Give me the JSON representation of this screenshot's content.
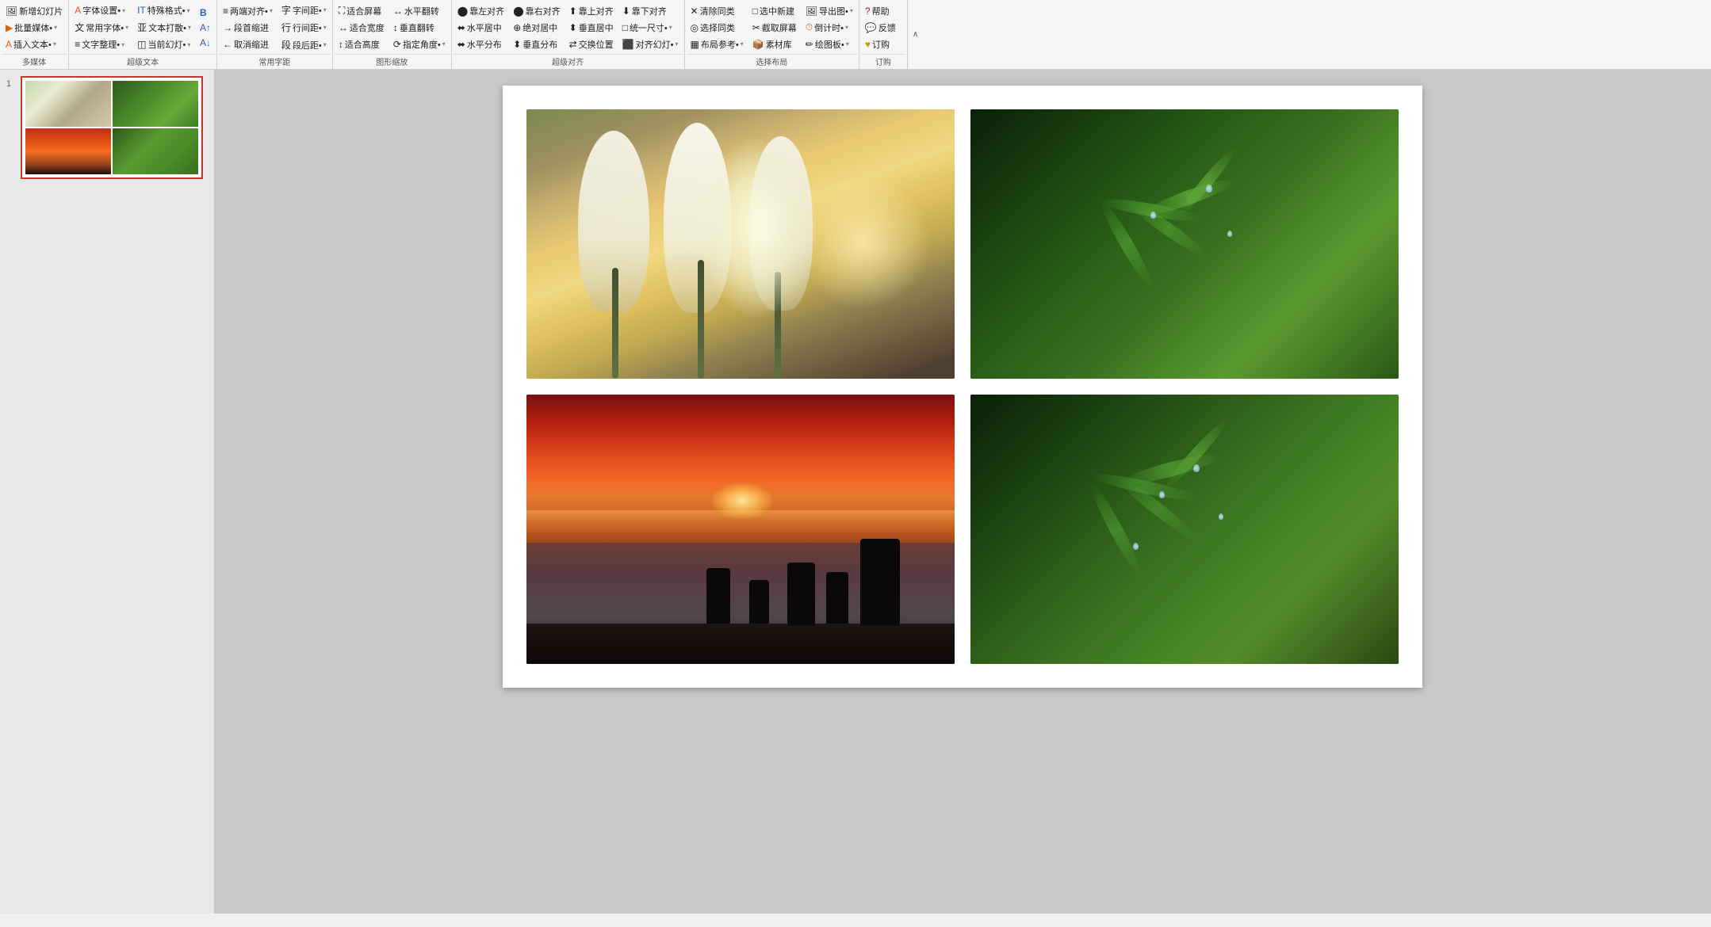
{
  "ribbon": {
    "groups": [
      {
        "id": "multimedia",
        "label": "多媒体",
        "rows": [
          [
            {
              "label": "新增幻灯片",
              "icon": "🖼",
              "hasArrow": false,
              "color": "normal"
            },
            {
              "label": "批量媒体•",
              "icon": "🎬",
              "hasArrow": true,
              "color": "orange"
            }
          ],
          [
            {
              "label": "插入文本•",
              "icon": "A",
              "hasArrow": true,
              "color": "orange"
            }
          ]
        ]
      },
      {
        "id": "supertext",
        "label": "超级文本",
        "rows": [
          [
            {
              "label": "字体设置•",
              "icon": "A",
              "hasArrow": true,
              "color": "orange"
            },
            {
              "label": "特殊格式•",
              "icon": "IT",
              "hasArrow": true,
              "color": "blue"
            },
            {
              "label": "B",
              "icon": "B",
              "hasArrow": false,
              "color": "blue"
            }
          ],
          [
            {
              "label": "常用字体•",
              "icon": "文",
              "hasArrow": true,
              "color": "normal"
            },
            {
              "label": "文本打散•",
              "icon": "亚",
              "hasArrow": true,
              "color": "normal"
            },
            {
              "label": "A↑",
              "icon": "A",
              "hasArrow": false,
              "color": "blue"
            }
          ],
          [
            {
              "label": "文字整理•",
              "icon": "≡",
              "hasArrow": true,
              "color": "normal"
            },
            {
              "label": "当前幻灯•",
              "icon": "◫",
              "hasArrow": true,
              "color": "normal"
            },
            {
              "label": "A↓",
              "icon": "A",
              "hasArrow": false,
              "color": "blue"
            }
          ]
        ]
      },
      {
        "id": "spacing",
        "label": "常用字距",
        "rows": [
          [
            {
              "label": "两端对齐•",
              "icon": "≡",
              "hasArrow": true
            },
            {
              "label": "字间距•",
              "icon": "字",
              "hasArrow": true
            }
          ],
          [
            {
              "label": "段首缩进",
              "icon": "→",
              "hasArrow": false
            },
            {
              "label": "行间距•",
              "icon": "行",
              "hasArrow": true
            }
          ],
          [
            {
              "label": "取消缩进",
              "icon": "←",
              "hasArrow": false
            },
            {
              "label": "段后距•",
              "icon": "段",
              "hasArrow": true
            }
          ]
        ]
      },
      {
        "id": "fitscreen",
        "label": "图形缩放",
        "rows": [
          [
            {
              "label": "适合屏幕",
              "icon": "⛶",
              "hasArrow": false
            },
            {
              "label": "水平翻转",
              "icon": "↔",
              "hasArrow": false
            }
          ],
          [
            {
              "label": "适合宽度",
              "icon": "↔",
              "hasArrow": false
            },
            {
              "label": "垂直翻转",
              "icon": "↕",
              "hasArrow": false
            }
          ],
          [
            {
              "label": "适合高度",
              "icon": "↕",
              "hasArrow": false
            },
            {
              "label": "指定角度•",
              "icon": "⟳",
              "hasArrow": true
            }
          ]
        ]
      },
      {
        "id": "superalign",
        "label": "超级对齐",
        "rows": [
          [
            {
              "label": "靠左对齐",
              "icon": "◧"
            },
            {
              "label": "靠右对齐",
              "icon": "◨"
            },
            {
              "label": "靠上对齐",
              "icon": "⬆"
            },
            {
              "label": "靠下对齐",
              "icon": "⬇"
            }
          ],
          [
            {
              "label": "水平居中",
              "icon": "⬌"
            },
            {
              "label": "绝对居中",
              "icon": "⊕"
            },
            {
              "label": "垂直居中",
              "icon": "⬍"
            },
            {
              "label": "统一尺寸•",
              "icon": "□",
              "hasArrow": true
            }
          ],
          [
            {
              "label": "水平分布",
              "icon": "⬌"
            },
            {
              "label": "垂直分布",
              "icon": "⬍"
            },
            {
              "label": "交换位置",
              "icon": "⇄"
            },
            {
              "label": "对齐幻灯•",
              "icon": "⬛",
              "hasArrow": true
            }
          ]
        ]
      },
      {
        "id": "selectlayout",
        "label": "选择布局",
        "rows": [
          [
            {
              "label": "清除同类",
              "icon": "✕"
            },
            {
              "label": "选中新建",
              "icon": "□"
            },
            {
              "label": "导出图•",
              "icon": "🖼",
              "hasArrow": true
            }
          ],
          [
            {
              "label": "选择同类",
              "icon": "◎"
            },
            {
              "label": "截取屏幕",
              "icon": "✂"
            },
            {
              "label": "倒计时•",
              "icon": "⏱",
              "hasArrow": true
            }
          ],
          [
            {
              "label": "布局参考•",
              "icon": "▦",
              "hasArrow": true
            },
            {
              "label": "素材库",
              "icon": "📦"
            },
            {
              "label": "绘图板•",
              "icon": "✏",
              "hasArrow": true
            }
          ]
        ]
      },
      {
        "id": "order",
        "label": "订购",
        "rows": [
          [
            {
              "label": "帮助",
              "icon": "?",
              "color": "red"
            }
          ],
          [
            {
              "label": "反馈",
              "icon": "💬",
              "color": "orange"
            }
          ],
          [
            {
              "label": "订购",
              "icon": "♥",
              "color": "gold"
            }
          ]
        ]
      }
    ],
    "collapse_label": "∧"
  },
  "slide_panel": {
    "slide_number": "1"
  },
  "slide": {
    "images": [
      {
        "id": "flowers",
        "type": "flowers",
        "label": "白色花朵图片"
      },
      {
        "id": "green-leaves",
        "type": "green",
        "label": "绿色叶片图片"
      },
      {
        "id": "sunset",
        "type": "sunset",
        "label": "日落海岸图片"
      },
      {
        "id": "green-leaves2",
        "type": "green2",
        "label": "绿色叶片图片2"
      }
    ]
  }
}
